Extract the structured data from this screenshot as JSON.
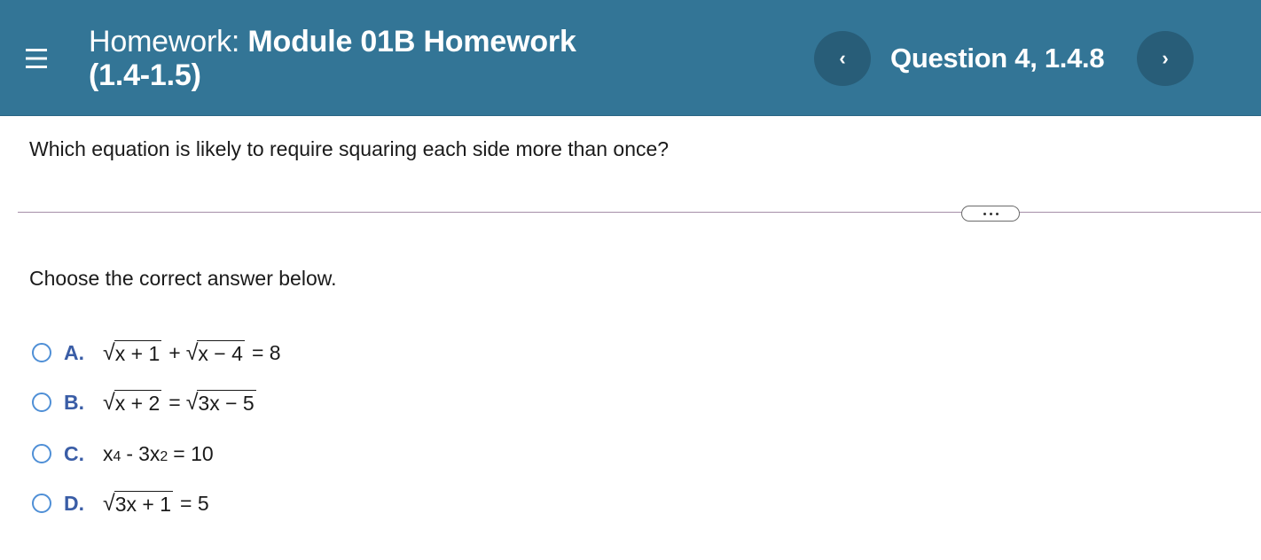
{
  "header": {
    "menu_icon": "hamburger-menu-icon",
    "title_label": "Homework:",
    "title_name": "Module 01B Homework",
    "title_range": "(1.4-1.5)",
    "prev_glyph": "‹",
    "next_glyph": "›",
    "question_label": "Question 4, 1.4.8"
  },
  "question": {
    "prompt": "Which equation is likely to require squaring each side more than once?",
    "more_icon": "ellipsis-icon",
    "instruction": "Choose the correct answer below."
  },
  "options": [
    {
      "letter": "A.",
      "radicand1": "x + 1",
      "op1": "+",
      "radicand2": "x − 4",
      "rhs": "= 8"
    },
    {
      "letter": "B.",
      "radicand1": "x + 2",
      "op1": "=",
      "radicand2": "3x − 5"
    },
    {
      "letter": "C.",
      "base1": "x",
      "exp1": "4",
      "op1": "-",
      "base2": "3x",
      "exp2": "2",
      "rhs": "= 10"
    },
    {
      "letter": "D.",
      "radicand1": "3x + 1",
      "rhs": "= 5"
    }
  ],
  "colors": {
    "header_bg": "#337596",
    "nav_button_bg": "#285d78",
    "option_letter": "#3a5da6",
    "radio_border": "#4f8fd6"
  }
}
